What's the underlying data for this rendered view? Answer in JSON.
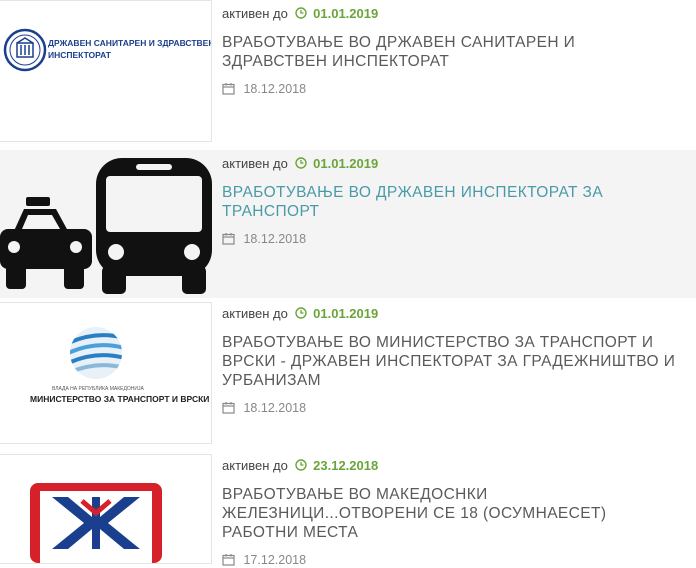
{
  "status_word": "активен до",
  "entries": [
    {
      "expires": "01.01.2019",
      "title": "ВРАБОТУВАЊЕ ВО ДРЖАВЕН САНИТАРЕН И ЗДРАВСТВЕН ИНСПЕКТОРАТ",
      "date": "18.12.2018",
      "thumb": {
        "type": "logo-text",
        "text_line1": "ДРЖАВЕН САНИТАРЕН И ЗДРАВСТВЕН",
        "text_line2": "ИНСПЕКТОРАТ"
      }
    },
    {
      "expires": "01.01.2019",
      "title": "ВРАБОТУВАЊЕ ВО ДРЖАВЕН ИНСПЕКТОРАТ ЗА ТРАНСПОРТ",
      "date": "18.12.2018",
      "thumb": {
        "type": "taxi-bus-icons"
      }
    },
    {
      "expires": "01.01.2019",
      "title": "ВРАБОТУВАЊЕ ВО МИНИСТЕРСТВО ЗА ТРАНСПОРТ И ВРСКИ - ДРЖАВЕН ИНСПЕКТОРАТ ЗА ГРАДЕЖНИШТВО И УРБАНИЗАМ",
      "date": "18.12.2018",
      "thumb": {
        "type": "ministry-logo",
        "small_text": "ВЛАДА НА РЕПУБЛИКА МАКЕДОНИЈА",
        "text": "МИНИСТЕРСТВО ЗА ТРАНСПОРТ И ВРСКИ"
      }
    },
    {
      "expires": "23.12.2018",
      "title": "ВРАБОТУВАЊЕ ВО МАКЕДОСНКИ ЖЕЛЕЗНИЦИ...ОТВОРЕНИ СЕ 18 (ОСУМНАЕСЕТ) РАБОТНИ МЕСТА",
      "date": "17.12.2018",
      "thumb": {
        "type": "railways-logo"
      }
    }
  ],
  "colors": {
    "status_date": "#6aa53a",
    "title": "#5a5a5a",
    "title_active": "#4a9aa8",
    "highlight_bg": "#f4f4f4",
    "logo_blue": "#1b3f8f",
    "rail_red": "#d6202a"
  }
}
